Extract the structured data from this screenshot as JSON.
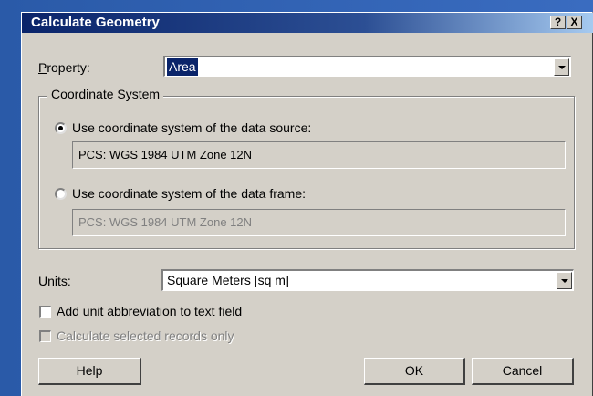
{
  "window": {
    "title": "Calculate Geometry",
    "help_glyph": "?",
    "close_glyph": "X"
  },
  "property": {
    "label": "Property:",
    "value": "Area"
  },
  "coordinate_system": {
    "legend": "Coordinate System",
    "data_source_label": "Use coordinate system of the data source:",
    "data_source_value": "PCS: WGS 1984 UTM Zone 12N",
    "data_frame_label": "Use coordinate system of the data frame:",
    "data_frame_value": "PCS: WGS 1984 UTM Zone 12N",
    "selected": "data_source"
  },
  "units": {
    "label": "Units:",
    "value": "Square Meters [sq m]"
  },
  "options": {
    "add_abbreviation_label": "Add unit abbreviation to text field",
    "selected_only_label": "Calculate selected records only"
  },
  "buttons": {
    "help": "Help",
    "ok": "OK",
    "cancel": "Cancel"
  }
}
